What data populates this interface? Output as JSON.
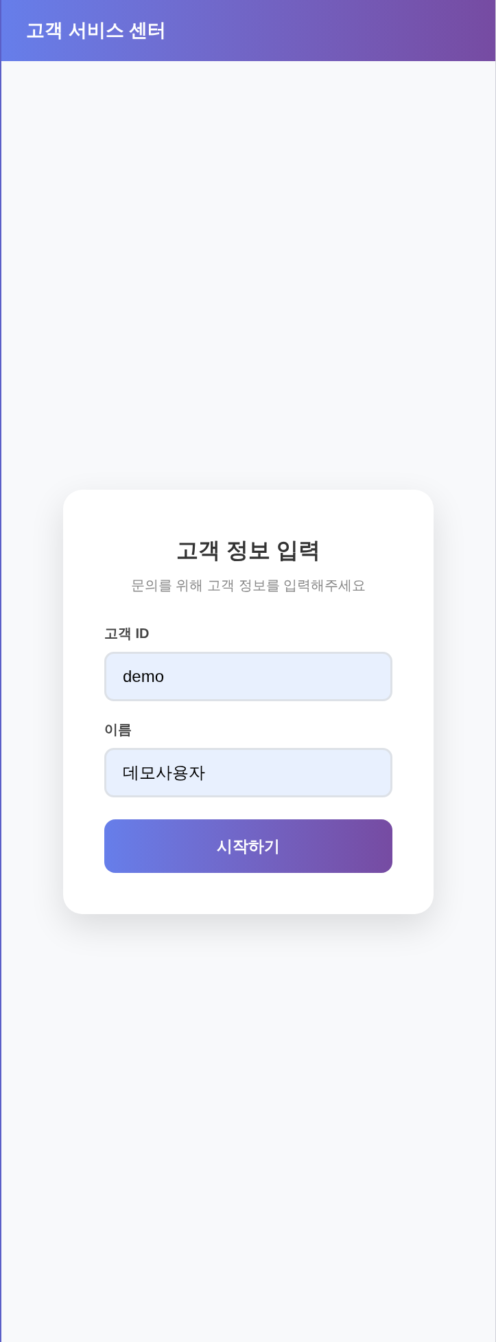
{
  "header": {
    "title": "고객 서비스 센터"
  },
  "card": {
    "title": "고객 정보 입력",
    "subtitle": "문의를 위해 고객 정보를 입력해주세요",
    "fields": [
      {
        "label": "고객 ID",
        "value": "demo"
      },
      {
        "label": "이름",
        "value": "데모사용자"
      }
    ],
    "button": "시작하기"
  }
}
